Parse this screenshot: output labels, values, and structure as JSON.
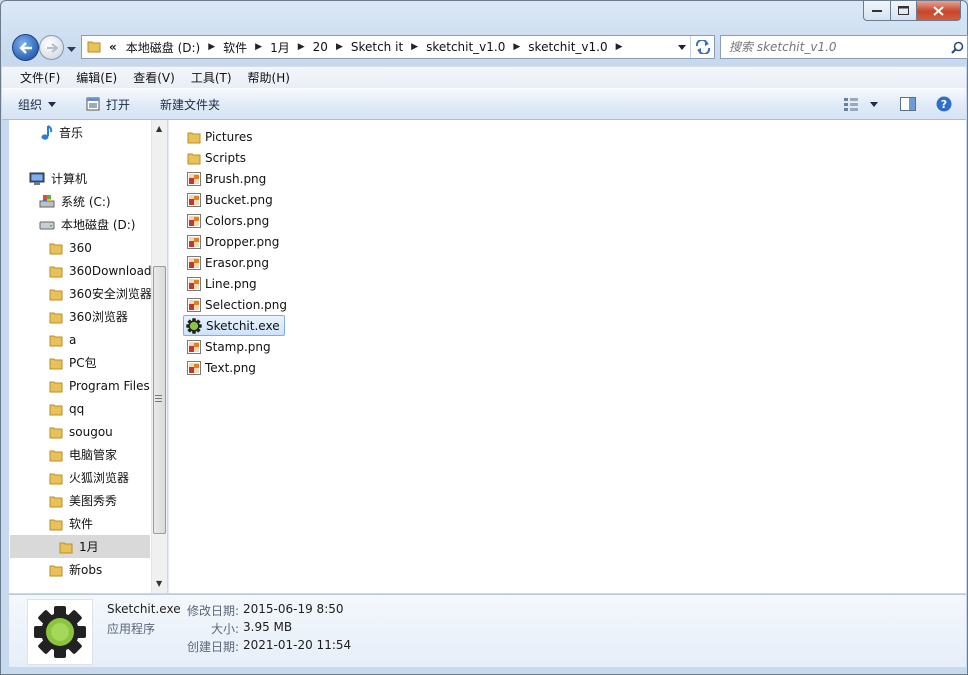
{
  "window": {
    "background_image_hint": ""
  },
  "address": {
    "lead": "«",
    "crumbs": [
      "本地磁盘 (D:)",
      "软件",
      "1月",
      "20",
      "Sketch it",
      "sketchit_v1.0",
      "sketchit_v1.0"
    ]
  },
  "search": {
    "placeholder": "搜索 sketchit_v1.0"
  },
  "menu": {
    "items": [
      "文件(F)",
      "编辑(E)",
      "查看(V)",
      "工具(T)",
      "帮助(H)"
    ]
  },
  "toolbar": {
    "organize": "组织",
    "open": "打开",
    "new_folder": "新建文件夹"
  },
  "nav_tree": {
    "items": [
      {
        "label": "音乐",
        "icon": "music-icon"
      },
      {
        "label": "计算机",
        "icon": "computer-icon"
      },
      {
        "label": "系统 (C:)",
        "icon": "system-drive-icon"
      },
      {
        "label": "本地磁盘 (D:)",
        "icon": "drive-icon"
      },
      {
        "label": "360",
        "icon": "folder-icon"
      },
      {
        "label": "360Downloads",
        "icon": "folder-icon"
      },
      {
        "label": "360安全浏览器",
        "icon": "folder-icon"
      },
      {
        "label": "360浏览器",
        "icon": "folder-icon"
      },
      {
        "label": "a",
        "icon": "folder-icon"
      },
      {
        "label": "PC包",
        "icon": "folder-icon"
      },
      {
        "label": "Program Files",
        "icon": "folder-icon"
      },
      {
        "label": "qq",
        "icon": "folder-icon"
      },
      {
        "label": "sougou",
        "icon": "folder-icon"
      },
      {
        "label": "电脑管家",
        "icon": "folder-icon"
      },
      {
        "label": "火狐浏览器",
        "icon": "folder-icon"
      },
      {
        "label": "美图秀秀",
        "icon": "folder-icon"
      },
      {
        "label": "软件",
        "icon": "folder-icon"
      },
      {
        "label": "1月",
        "icon": "folder-icon"
      },
      {
        "label": "新obs",
        "icon": "folder-icon"
      }
    ]
  },
  "files": [
    {
      "name": "Pictures",
      "type": "folder"
    },
    {
      "name": "Scripts",
      "type": "folder"
    },
    {
      "name": "Brush.png",
      "type": "png"
    },
    {
      "name": "Bucket.png",
      "type": "png"
    },
    {
      "name": "Colors.png",
      "type": "png"
    },
    {
      "name": "Dropper.png",
      "type": "png"
    },
    {
      "name": "Erasor.png",
      "type": "png"
    },
    {
      "name": "Line.png",
      "type": "png"
    },
    {
      "name": "Selection.png",
      "type": "png"
    },
    {
      "name": "Sketchit.exe",
      "type": "exe",
      "selected": true
    },
    {
      "name": "Stamp.png",
      "type": "png"
    },
    {
      "name": "Text.png",
      "type": "png"
    }
  ],
  "details": {
    "name": "Sketchit.exe",
    "type": "应用程序",
    "modified_label": "修改日期:",
    "modified_value": "2015-06-19 8:50",
    "size_label": "大小:",
    "size_value": "3.95 MB",
    "created_label": "创建日期:",
    "created_value": "2021-01-20 11:54"
  },
  "colors": {
    "folder": "#e8c158",
    "selection_border": "#84acdd",
    "exe_gear": "#8bc53f"
  }
}
